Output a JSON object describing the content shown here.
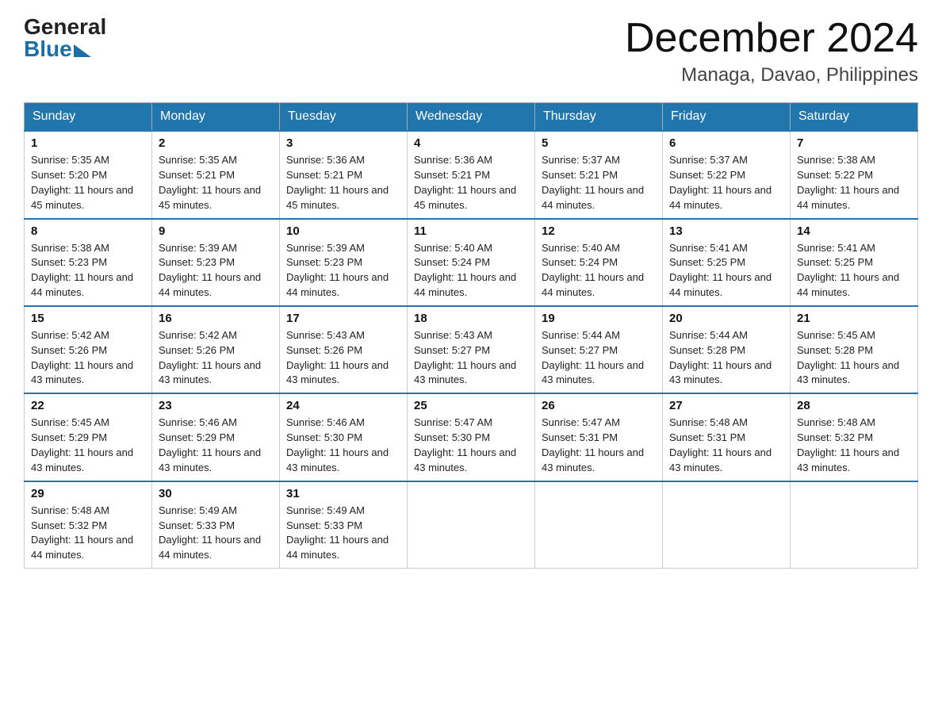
{
  "header": {
    "logo_general": "General",
    "logo_blue": "Blue",
    "title": "December 2024",
    "location": "Managa, Davao, Philippines"
  },
  "days_of_week": [
    "Sunday",
    "Monday",
    "Tuesday",
    "Wednesday",
    "Thursday",
    "Friday",
    "Saturday"
  ],
  "weeks": [
    [
      {
        "day": "1",
        "sunrise": "5:35 AM",
        "sunset": "5:20 PM",
        "daylight": "11 hours and 45 minutes."
      },
      {
        "day": "2",
        "sunrise": "5:35 AM",
        "sunset": "5:21 PM",
        "daylight": "11 hours and 45 minutes."
      },
      {
        "day": "3",
        "sunrise": "5:36 AM",
        "sunset": "5:21 PM",
        "daylight": "11 hours and 45 minutes."
      },
      {
        "day": "4",
        "sunrise": "5:36 AM",
        "sunset": "5:21 PM",
        "daylight": "11 hours and 45 minutes."
      },
      {
        "day": "5",
        "sunrise": "5:37 AM",
        "sunset": "5:21 PM",
        "daylight": "11 hours and 44 minutes."
      },
      {
        "day": "6",
        "sunrise": "5:37 AM",
        "sunset": "5:22 PM",
        "daylight": "11 hours and 44 minutes."
      },
      {
        "day": "7",
        "sunrise": "5:38 AM",
        "sunset": "5:22 PM",
        "daylight": "11 hours and 44 minutes."
      }
    ],
    [
      {
        "day": "8",
        "sunrise": "5:38 AM",
        "sunset": "5:23 PM",
        "daylight": "11 hours and 44 minutes."
      },
      {
        "day": "9",
        "sunrise": "5:39 AM",
        "sunset": "5:23 PM",
        "daylight": "11 hours and 44 minutes."
      },
      {
        "day": "10",
        "sunrise": "5:39 AM",
        "sunset": "5:23 PM",
        "daylight": "11 hours and 44 minutes."
      },
      {
        "day": "11",
        "sunrise": "5:40 AM",
        "sunset": "5:24 PM",
        "daylight": "11 hours and 44 minutes."
      },
      {
        "day": "12",
        "sunrise": "5:40 AM",
        "sunset": "5:24 PM",
        "daylight": "11 hours and 44 minutes."
      },
      {
        "day": "13",
        "sunrise": "5:41 AM",
        "sunset": "5:25 PM",
        "daylight": "11 hours and 44 minutes."
      },
      {
        "day": "14",
        "sunrise": "5:41 AM",
        "sunset": "5:25 PM",
        "daylight": "11 hours and 44 minutes."
      }
    ],
    [
      {
        "day": "15",
        "sunrise": "5:42 AM",
        "sunset": "5:26 PM",
        "daylight": "11 hours and 43 minutes."
      },
      {
        "day": "16",
        "sunrise": "5:42 AM",
        "sunset": "5:26 PM",
        "daylight": "11 hours and 43 minutes."
      },
      {
        "day": "17",
        "sunrise": "5:43 AM",
        "sunset": "5:26 PM",
        "daylight": "11 hours and 43 minutes."
      },
      {
        "day": "18",
        "sunrise": "5:43 AM",
        "sunset": "5:27 PM",
        "daylight": "11 hours and 43 minutes."
      },
      {
        "day": "19",
        "sunrise": "5:44 AM",
        "sunset": "5:27 PM",
        "daylight": "11 hours and 43 minutes."
      },
      {
        "day": "20",
        "sunrise": "5:44 AM",
        "sunset": "5:28 PM",
        "daylight": "11 hours and 43 minutes."
      },
      {
        "day": "21",
        "sunrise": "5:45 AM",
        "sunset": "5:28 PM",
        "daylight": "11 hours and 43 minutes."
      }
    ],
    [
      {
        "day": "22",
        "sunrise": "5:45 AM",
        "sunset": "5:29 PM",
        "daylight": "11 hours and 43 minutes."
      },
      {
        "day": "23",
        "sunrise": "5:46 AM",
        "sunset": "5:29 PM",
        "daylight": "11 hours and 43 minutes."
      },
      {
        "day": "24",
        "sunrise": "5:46 AM",
        "sunset": "5:30 PM",
        "daylight": "11 hours and 43 minutes."
      },
      {
        "day": "25",
        "sunrise": "5:47 AM",
        "sunset": "5:30 PM",
        "daylight": "11 hours and 43 minutes."
      },
      {
        "day": "26",
        "sunrise": "5:47 AM",
        "sunset": "5:31 PM",
        "daylight": "11 hours and 43 minutes."
      },
      {
        "day": "27",
        "sunrise": "5:48 AM",
        "sunset": "5:31 PM",
        "daylight": "11 hours and 43 minutes."
      },
      {
        "day": "28",
        "sunrise": "5:48 AM",
        "sunset": "5:32 PM",
        "daylight": "11 hours and 43 minutes."
      }
    ],
    [
      {
        "day": "29",
        "sunrise": "5:48 AM",
        "sunset": "5:32 PM",
        "daylight": "11 hours and 44 minutes."
      },
      {
        "day": "30",
        "sunrise": "5:49 AM",
        "sunset": "5:33 PM",
        "daylight": "11 hours and 44 minutes."
      },
      {
        "day": "31",
        "sunrise": "5:49 AM",
        "sunset": "5:33 PM",
        "daylight": "11 hours and 44 minutes."
      },
      null,
      null,
      null,
      null
    ]
  ]
}
